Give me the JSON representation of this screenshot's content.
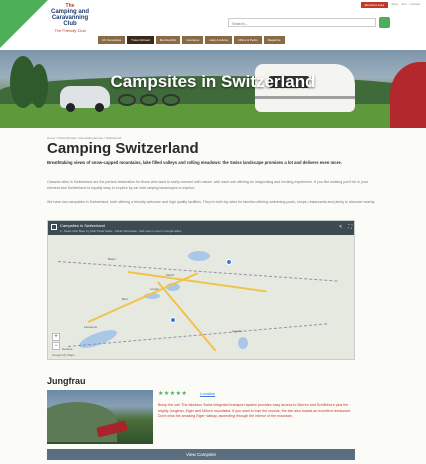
{
  "top_links": [
    "Members Area",
    "Shop",
    "Join",
    "Contact"
  ],
  "logo": {
    "line1": "The",
    "line2": "Camping and Caravanning Club",
    "tagline": "The Friendly Club"
  },
  "search": {
    "placeholder": "Search..."
  },
  "nav": [
    "UK Campsites",
    "Travel Abroad",
    "Membership",
    "Insurance",
    "Help & Advice",
    "Offers & Perks",
    "Magazine"
  ],
  "hero": {
    "title": "Campsites in Switzerland"
  },
  "breadcrumb": "Home / Travel Abroad / Campsites Europe / Switzerland",
  "page": {
    "title": "Camping Switzerland",
    "lead": "Breathtaking views of snow-capped mountains, lake filled valleys and rolling meadows: the Swiss landscape promises a lot and delivers even more.",
    "para1": "Caravan sites in Switzerland are the perfect destination for those who want to really connect with nature, with each one offering an invigorating and exciting experience. If you like walking you'll be in your element and Switzerland is equally easy to explore by car with varying landscapes to explore.",
    "para2": "We have two campsites in Switzerland, both offering a friendly welcome and high quality facilities. They're both top sites for families offering swimming pools, shops, restaurants and plenty to discover nearby."
  },
  "map": {
    "title": "Campsites in Switzerland",
    "subtitle": "2 - Swiss Club Sites, by Club Travel Swiss - Public information - Edit map or open in Google Maps",
    "footer": "Google  My Maps",
    "cities": [
      "Basel",
      "Zürich",
      "Bern",
      "Luzern",
      "Lausanne",
      "Genève",
      "Lugano"
    ]
  },
  "listing": {
    "name": "Jungfrau",
    "rating": "★★★★★",
    "location_link": "Location",
    "description": "Bump the car! The fabulous Swiss integrated transport system provides easy access to Mürren and Schilthhorn plus the mighty Jungfrau, Eiger and Mönch mountains. If you want to lose the crowds, the site also boasts an excellent restaurant. Don't miss the amazing Eiger railway, ascending through the interior of the mountain.",
    "button": "View Campsite"
  },
  "colors": {
    "green": "#4cae56",
    "nav": "#8a6a45",
    "nav_active": "#3b2a1a",
    "button": "#5a6e80",
    "desc": "#c0392b"
  }
}
